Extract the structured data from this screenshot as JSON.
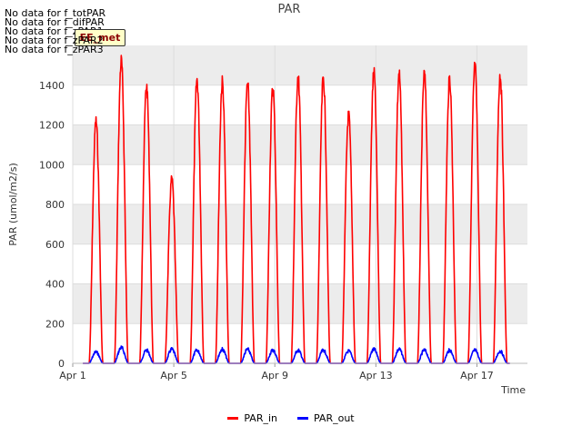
{
  "no_data_messages": [
    "No data for f_totPAR",
    "No data for f_difPAR",
    "No data for f_zPAR1",
    "No data for f_zPAR2",
    "No data for f_zPAR3"
  ],
  "badge_label": "EE_met",
  "chart_data": {
    "type": "line",
    "title": "PAR",
    "xlabel": "Time",
    "ylabel": "PAR (umol/m2/s)",
    "xlim": [
      0.0,
      18.0
    ],
    "ylim": [
      0,
      1600
    ],
    "x_ticks": [
      {
        "value": 0,
        "label": "Apr 1"
      },
      {
        "value": 4,
        "label": "Apr 5"
      },
      {
        "value": 8,
        "label": "Apr 9"
      },
      {
        "value": 12,
        "label": "Apr 13"
      },
      {
        "value": 16,
        "label": "Apr 17"
      }
    ],
    "y_ticks": [
      0,
      200,
      400,
      600,
      800,
      1000,
      1200,
      1400
    ],
    "grid": true,
    "legend_position": "bottom-center",
    "colors": {
      "PAR_in": "#ff0000",
      "PAR_out": "#0000ff",
      "band": "#ececec",
      "plot_bg": "#ffffff"
    },
    "series": [
      {
        "name": "PAR_in",
        "day_peaks": [
          {
            "day": 0,
            "peak": 1250
          },
          {
            "day": 1,
            "peak": 1560
          },
          {
            "day": 2,
            "peak": 1430
          },
          {
            "day": 3,
            "peak": 950
          },
          {
            "day": 4,
            "peak": 1460
          },
          {
            "day": 5,
            "peak": 1450
          },
          {
            "day": 6,
            "peak": 1440
          },
          {
            "day": 7,
            "peak": 1420
          },
          {
            "day": 8,
            "peak": 1480
          },
          {
            "day": 9,
            "peak": 1470
          },
          {
            "day": 10,
            "peak": 1280
          },
          {
            "day": 11,
            "peak": 1500
          },
          {
            "day": 12,
            "peak": 1490
          },
          {
            "day": 13,
            "peak": 1490
          },
          {
            "day": 14,
            "peak": 1470
          },
          {
            "day": 15,
            "peak": 1530
          },
          {
            "day": 16,
            "peak": 1490
          }
        ]
      },
      {
        "name": "PAR_out",
        "day_peaks": [
          {
            "day": 0,
            "peak": 65
          },
          {
            "day": 1,
            "peak": 90
          },
          {
            "day": 2,
            "peak": 75
          },
          {
            "day": 3,
            "peak": 80
          },
          {
            "day": 4,
            "peak": 75
          },
          {
            "day": 5,
            "peak": 80
          },
          {
            "day": 6,
            "peak": 80
          },
          {
            "day": 7,
            "peak": 75
          },
          {
            "day": 8,
            "peak": 75
          },
          {
            "day": 9,
            "peak": 75
          },
          {
            "day": 10,
            "peak": 70
          },
          {
            "day": 11,
            "peak": 80
          },
          {
            "day": 12,
            "peak": 80
          },
          {
            "day": 13,
            "peak": 75
          },
          {
            "day": 14,
            "peak": 75
          },
          {
            "day": 15,
            "peak": 75
          },
          {
            "day": 16,
            "peak": 70
          }
        ]
      }
    ]
  }
}
